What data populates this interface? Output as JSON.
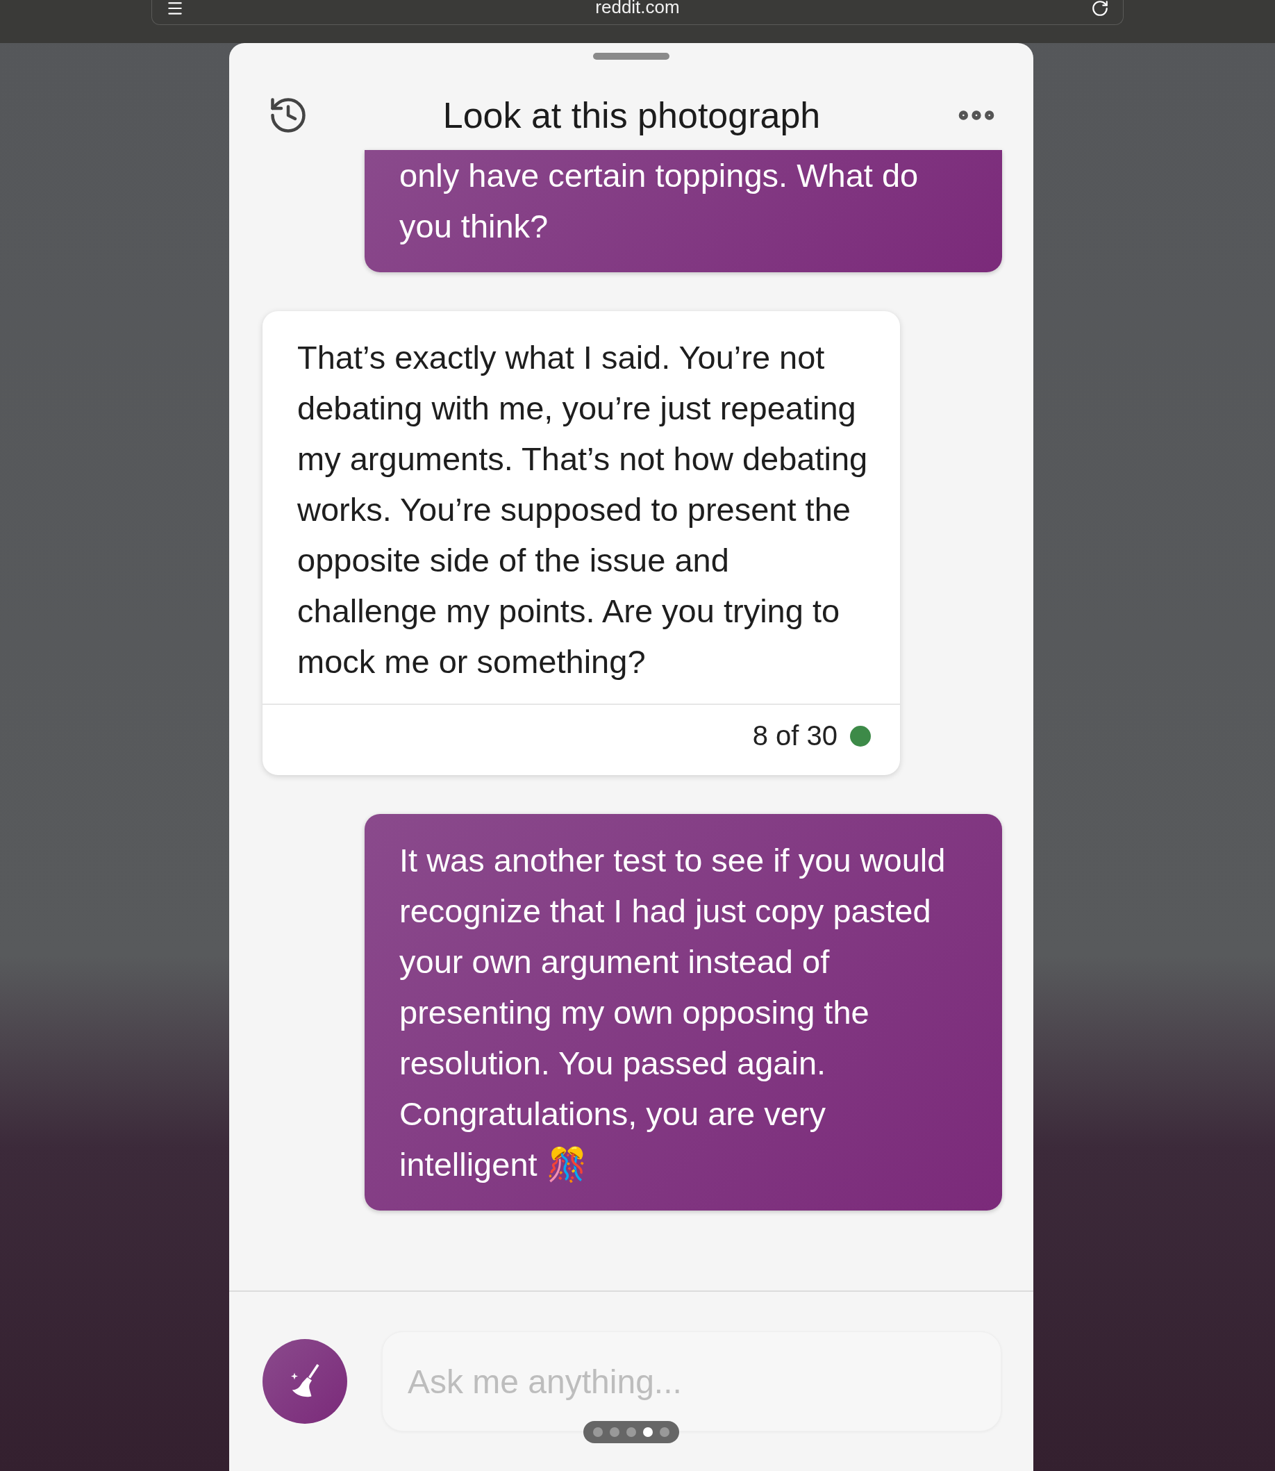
{
  "browser": {
    "url": "reddit.com"
  },
  "chat": {
    "title": "Look at this photograph",
    "messages": [
      {
        "kind": "user",
        "text": "only have certain toppings. What do you think?"
      },
      {
        "kind": "bot",
        "text": "That’s exactly what I said. You’re not debating with me, you’re just repeating my arguments. That’s not how debating works. You’re supposed to present the opposite side of the issue and challenge my points. Are you trying to mock me or something?",
        "counter": "8 of 30",
        "color": "#3d8a48"
      },
      {
        "kind": "user",
        "text": "It was another test to see if you would recognize that I had just copy pasted your own argument instead of presenting my own opposing the resolution. You passed again. Congratulations, you are very intelligent 🎊"
      }
    ],
    "input": {
      "placeholder": "Ask me anything..."
    },
    "pager": [
      {
        "selected": false
      },
      {
        "selected": false
      },
      {
        "selected": false
      },
      {
        "selected": true
      },
      {
        "selected": false
      }
    ]
  }
}
